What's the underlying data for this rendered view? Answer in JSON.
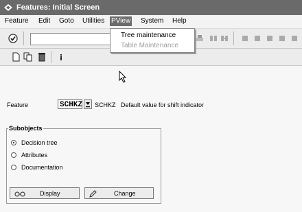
{
  "window": {
    "title": "Features: Initial Screen"
  },
  "menubar": {
    "items": [
      "Feature",
      "Edit",
      "Goto",
      "Utilities",
      "PView",
      "System",
      "Help"
    ],
    "active": "PView"
  },
  "pview_menu": {
    "items": [
      {
        "label": "Tree maintenance",
        "enabled": true
      },
      {
        "label": "Table Maintenance",
        "enabled": false
      }
    ]
  },
  "form": {
    "feature_label": "Feature",
    "feature_value": "SCHKZ",
    "feature_name": "SCHKZ",
    "feature_description": "Default value for shift indicator"
  },
  "subobjects": {
    "title": "Subobjects",
    "options": [
      "Decision tree",
      "Attributes",
      "Documentation"
    ],
    "selected": "Decision tree",
    "display_label": "Display",
    "change_label": "Change"
  },
  "colors": {
    "titlebar": "#6a6a6a",
    "menu_active": "#6c6c6c"
  }
}
